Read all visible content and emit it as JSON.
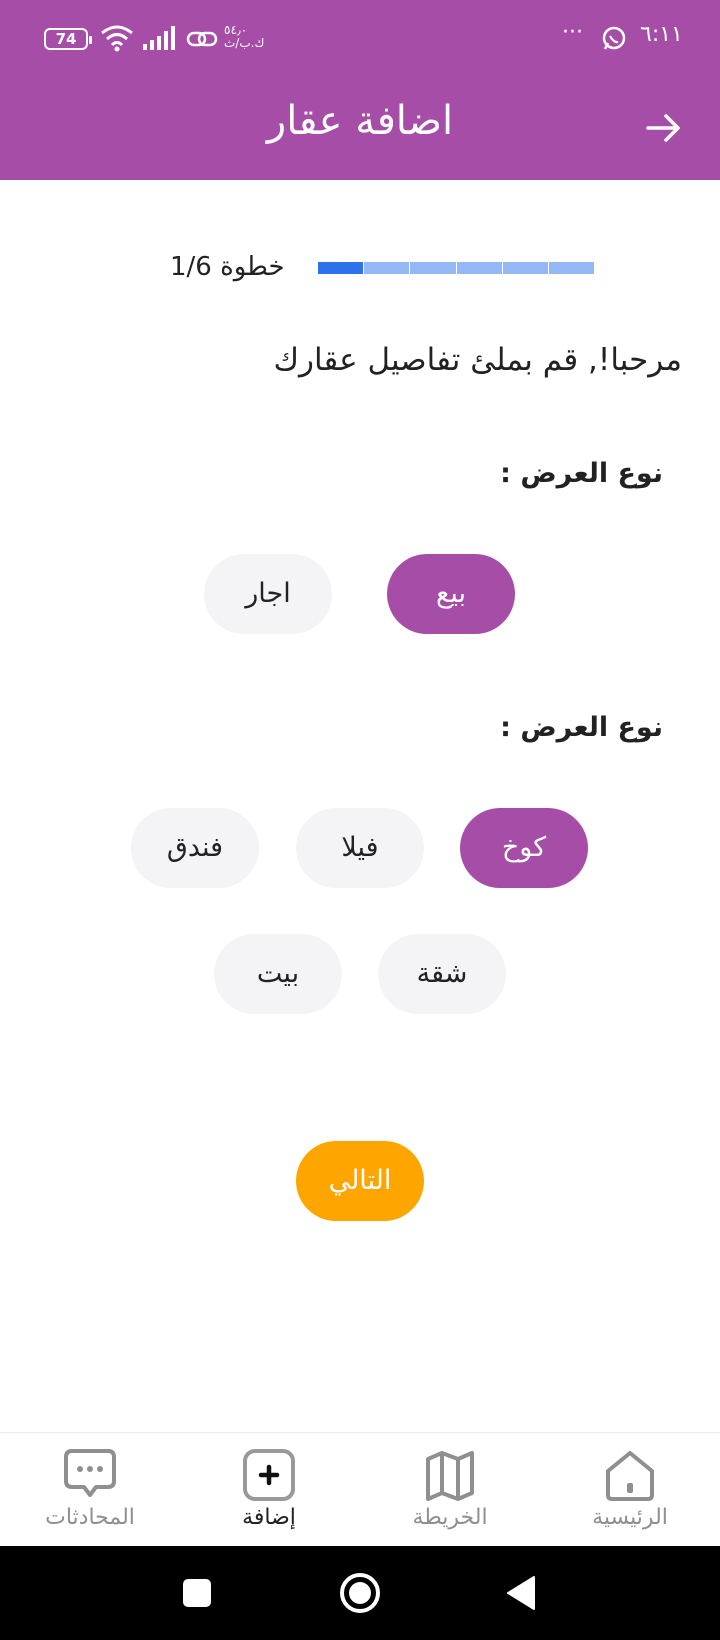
{
  "status_bar": {
    "time": "٦:١١",
    "more": "···",
    "speed": "٥٤٫٠\nك.ب/ث",
    "battery": "74"
  },
  "app_bar": {
    "title": "اضافة عقار",
    "back_icon": "arrow-right-icon"
  },
  "progress": {
    "label": "خطوة 1/6",
    "current_step": 1,
    "total_steps": 6,
    "fill_color": "#2e72ea",
    "track_color": "#93b8f5"
  },
  "welcome_text": "مرحبا!, قم بملئ تفاصيل عقارك",
  "offer_type": {
    "label": "نوع العرض :",
    "options": [
      {
        "label": "بيع",
        "selected": true
      },
      {
        "label": "اجار",
        "selected": false
      }
    ]
  },
  "property_type": {
    "label": "نوع العرض :",
    "options": [
      {
        "label": "كوخ",
        "selected": true
      },
      {
        "label": "فيلا",
        "selected": false
      },
      {
        "label": "فندق",
        "selected": false
      },
      {
        "label": "شقة",
        "selected": false
      },
      {
        "label": "بيت",
        "selected": false
      }
    ]
  },
  "next_button": {
    "label": "التالي",
    "color": "#ffa500"
  },
  "bottom_nav": {
    "items": [
      {
        "label": "الرئيسية",
        "icon": "home-icon",
        "active": false
      },
      {
        "label": "الخريطة",
        "icon": "map-icon",
        "active": false
      },
      {
        "label": "إضافة",
        "icon": "add-icon",
        "active": true
      },
      {
        "label": "المحادثات",
        "icon": "chat-icon",
        "active": false
      }
    ]
  },
  "theme": {
    "primary": "#a64ea7",
    "chip_bg": "#f4f4f7"
  }
}
